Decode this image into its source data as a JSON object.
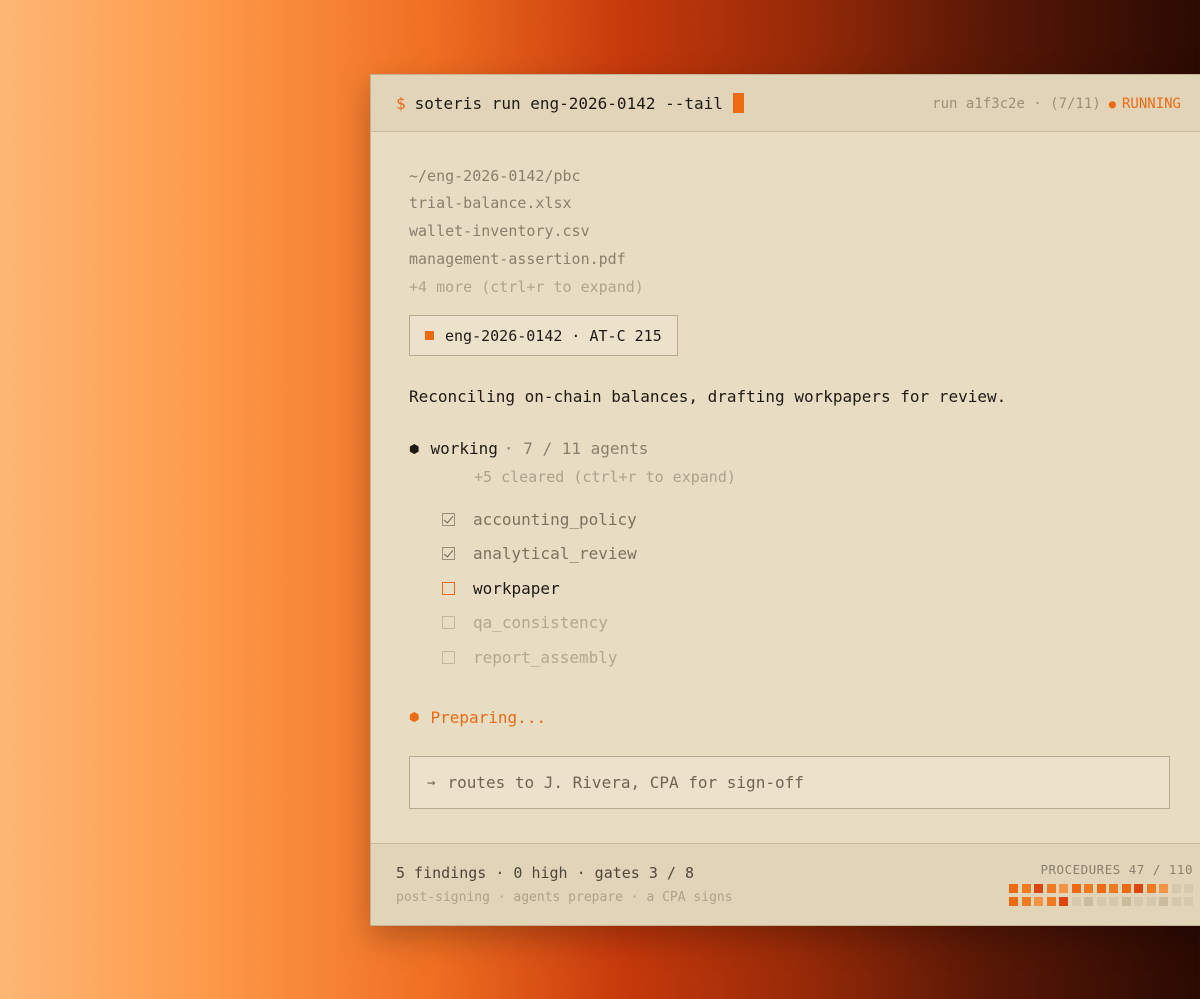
{
  "titlebar": {
    "prompt_symbol": "$",
    "command": "soteris run eng-2026-0142 --tail",
    "run_id": "run a1f3c2e · (7/11)",
    "status": "RUNNING"
  },
  "pbc": {
    "path": "~/eng-2026-0142/pbc",
    "files": [
      "trial-balance.xlsx",
      "wallet-inventory.csv",
      "management-assertion.pdf"
    ],
    "more": "+4 more (ctrl+r to expand)"
  },
  "engagement_tag": "eng-2026-0142 · AT-C 215",
  "summary": "Reconciling on-chain balances, drafting workpapers for review.",
  "working": {
    "label": "working",
    "count": "· 7 / 11 agents",
    "cleared": "+5 cleared (ctrl+r to expand)",
    "tasks": [
      {
        "name": "accounting_policy",
        "state": "done"
      },
      {
        "name": "analytical_review",
        "state": "done"
      },
      {
        "name": "workpaper",
        "state": "active"
      },
      {
        "name": "qa_consistency",
        "state": "todo"
      },
      {
        "name": "report_assembly",
        "state": "todo"
      }
    ]
  },
  "preparing": "Preparing...",
  "route": {
    "arrow": "→",
    "text": "routes to J. Rivera, CPA for sign-off"
  },
  "footer": {
    "stats": "5 findings · 0 high · gates 3 / 8",
    "tagline": "post-signing · agents prepare · a CPA signs",
    "procedures_label": "PROCEDURES 47 / 110",
    "procedure_cells": [
      "#ee6a12",
      "#ef7a1f",
      "#dd4410",
      "#ef7a1f",
      "#f49344",
      "#ee6a12",
      "#ef7a1f",
      "#ee6a12",
      "#ef7a1f",
      "#ee6a12",
      "#dd4410",
      "#ef7a1f",
      "#f49344",
      "#d6c8ac",
      "#d6c8ac",
      "#ee6a12",
      "#ef7a1f",
      "#f49344",
      "#ef7a1f",
      "#dd4410",
      "#d6c8ac",
      "#c9bb9c",
      "#d6c8ac",
      "#d6c8ac",
      "#c9bb9c",
      "#d6c8ac",
      "#d6c8ac",
      "#c9bb9c",
      "#d6c8ac",
      "#d6c8ac"
    ]
  },
  "colors": {
    "accent": "#ee6a12",
    "window_bg": "#e8dcc2"
  }
}
